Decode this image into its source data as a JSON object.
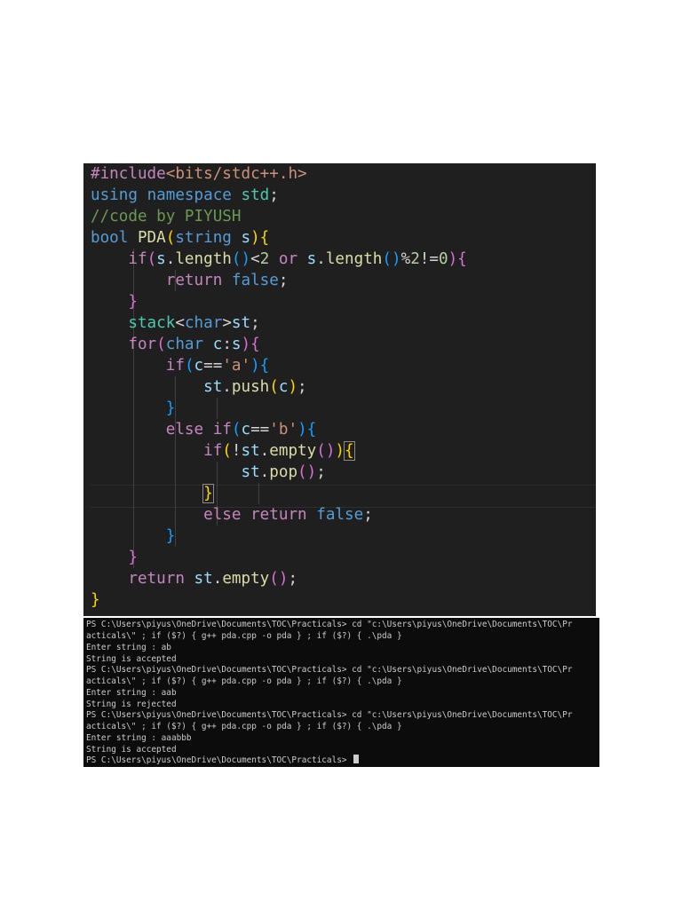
{
  "editor": {
    "lines": [
      "#include<bits/stdc++.h>",
      "using namespace std;",
      "//code by PIYUSH",
      "bool PDA(string s){",
      "    if(s.length()<2 or s.length()%2!=0){",
      "        return false;",
      "    }",
      "    stack<char>st;",
      "    for(char c:s){",
      "        if(c=='a'){",
      "            st.push(c);",
      "        }",
      "        else if(c=='b'){",
      "            if(!st.empty()){",
      "                st.pop();",
      "            }",
      "            else return false;",
      "        }",
      "    }",
      "    return st.empty();",
      "}"
    ]
  },
  "terminal": {
    "lines": [
      "PS C:\\Users\\piyus\\OneDrive\\Documents\\TOC\\Practicals> cd \"c:\\Users\\piyus\\OneDrive\\Documents\\TOC\\Pr",
      "acticals\\\" ; if ($?) { g++ pda.cpp -o pda } ; if ($?) { .\\pda }",
      "Enter string : ab",
      "String is accepted",
      "PS C:\\Users\\piyus\\OneDrive\\Documents\\TOC\\Practicals> cd \"c:\\Users\\piyus\\OneDrive\\Documents\\TOC\\Pr",
      "acticals\\\" ; if ($?) { g++ pda.cpp -o pda } ; if ($?) { .\\pda }",
      "Enter string : aab",
      "String is rejected",
      "PS C:\\Users\\piyus\\OneDrive\\Documents\\TOC\\Practicals> cd \"c:\\Users\\piyus\\OneDrive\\Documents\\TOC\\Pr",
      "acticals\\\" ; if ($?) { g++ pda.cpp -o pda } ; if ($?) { .\\pda }",
      "Enter string : aaabbb",
      "String is accepted",
      "PS C:\\Users\\piyus\\OneDrive\\Documents\\TOC\\Practicals> "
    ]
  },
  "colors": {
    "editor_bg": "#1f1f1f",
    "terminal_bg": "#0c0c0c",
    "keyword": "#c586c0",
    "type": "#569cd6",
    "function": "#dcdcaa",
    "variable": "#9cdcfe",
    "comment": "#6a9955",
    "string": "#ce9178",
    "bracket_gold": "#ffd700",
    "bracket_orchid": "#da70d6",
    "bracket_blue": "#179fff"
  }
}
